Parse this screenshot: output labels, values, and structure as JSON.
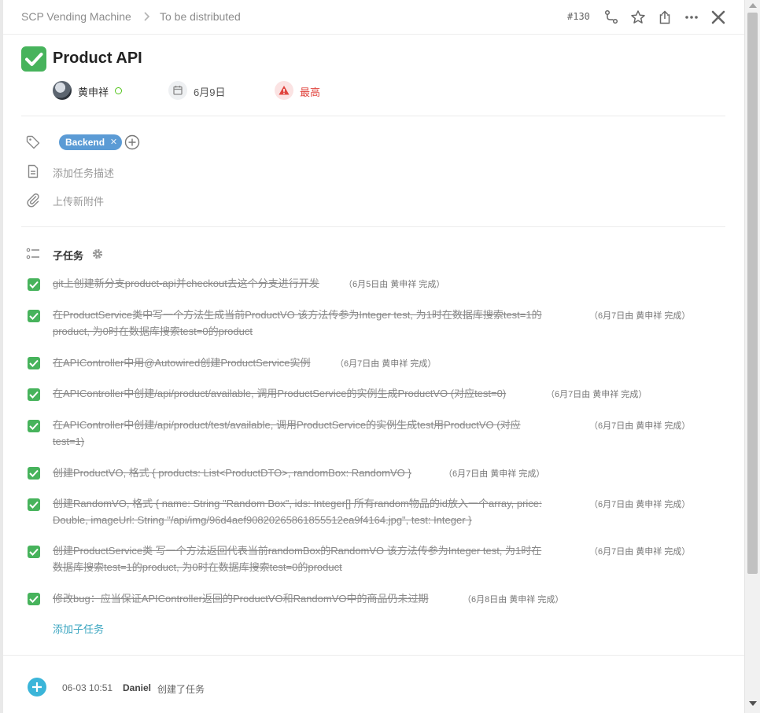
{
  "breadcrumb": {
    "project": "SCP Vending Machine",
    "list": "To be distributed"
  },
  "task": {
    "id": "#130",
    "title": "Product API",
    "assignee": "黄申祥",
    "due_date": "6月9日",
    "priority": "最高",
    "tag": "Backend",
    "add_description": "添加任务描述",
    "upload_attachment": "上传新附件"
  },
  "subtasks_section": {
    "heading": "子任务",
    "add_label": "添加子任务",
    "items": [
      {
        "line1": "git上创建新分支product-api并checkout去这个分支进行开发",
        "line2": "",
        "meta": "（6月5日由 黄申祥 完成）",
        "done": true
      },
      {
        "line1": "在ProductService类中写一个方法生成当前ProductVO 该方法传参为Integer test, 为1时在数据库搜索test=1的",
        "line2": "product, 为0时在数据库搜索test=0的product",
        "meta": "（6月7日由 黄申祥 完成）",
        "done": true
      },
      {
        "line1": "在APIController中用@Autowired创建ProductService实例",
        "line2": "",
        "meta": "（6月7日由 黄申祥 完成）",
        "done": true
      },
      {
        "line1": "在APIController中创建/api/product/available, 调用ProductService的实例生成ProductVO (对应test=0)",
        "line2": "",
        "meta": "（6月7日由 黄申祥 完成）",
        "done": true
      },
      {
        "line1": "在APIController中创建/api/product/test/available, 调用ProductService的实例生成test用ProductVO (对应",
        "line2": "test=1)",
        "meta": "（6月7日由 黄申祥 完成）",
        "done": true
      },
      {
        "line1": "创建ProductVO, 格式 { products: List<ProductDTO>, randomBox: RandomVO }",
        "line2": "",
        "meta": "（6月7日由 黄申祥 完成）",
        "done": true
      },
      {
        "line1": "创建RandomVO, 格式 { name: String \"Random Box\", ids: Integer[] 所有random物品的id放入一个array, price:",
        "line2": "Double, imageUrl: String \"/api/img/96d4aef90820265861855512ea9f4164.jpg\", test: Integer }",
        "meta": "（6月7日由 黄申祥 完成）",
        "done": true
      },
      {
        "line1": "创建ProductService类 写一个方法返回代表当前randomBox的RandomVO 该方法传参为Integer test, 为1时在",
        "line2": "数据库搜索test=1的product, 为0时在数据库搜索test=0的product",
        "meta": "（6月7日由 黄申祥 完成）",
        "done": true
      },
      {
        "line1": "修改bug：应当保证APIController返回的ProductVO和RandomVO中的商品仍未过期",
        "line2": "",
        "meta": "（6月8日由 黄申祥 完成）",
        "done": true
      }
    ]
  },
  "activity": {
    "time": "06-03 10:51",
    "user": "Daniel",
    "action": "创建了任务"
  },
  "colors": {
    "done_green": "#47b35c",
    "tag_blue": "#5b9bd5",
    "priority_red": "#e0443e",
    "link_teal": "#3aa5c0"
  },
  "icons": [
    "chevron-right-icon",
    "branch-icon",
    "star-icon",
    "share-icon",
    "more-icon",
    "close-icon",
    "calendar-icon",
    "warning-icon",
    "tag-icon",
    "plus-circle-icon",
    "document-icon",
    "paperclip-icon",
    "list-icon",
    "gear-icon",
    "checkmark-icon",
    "plus-icon"
  ]
}
